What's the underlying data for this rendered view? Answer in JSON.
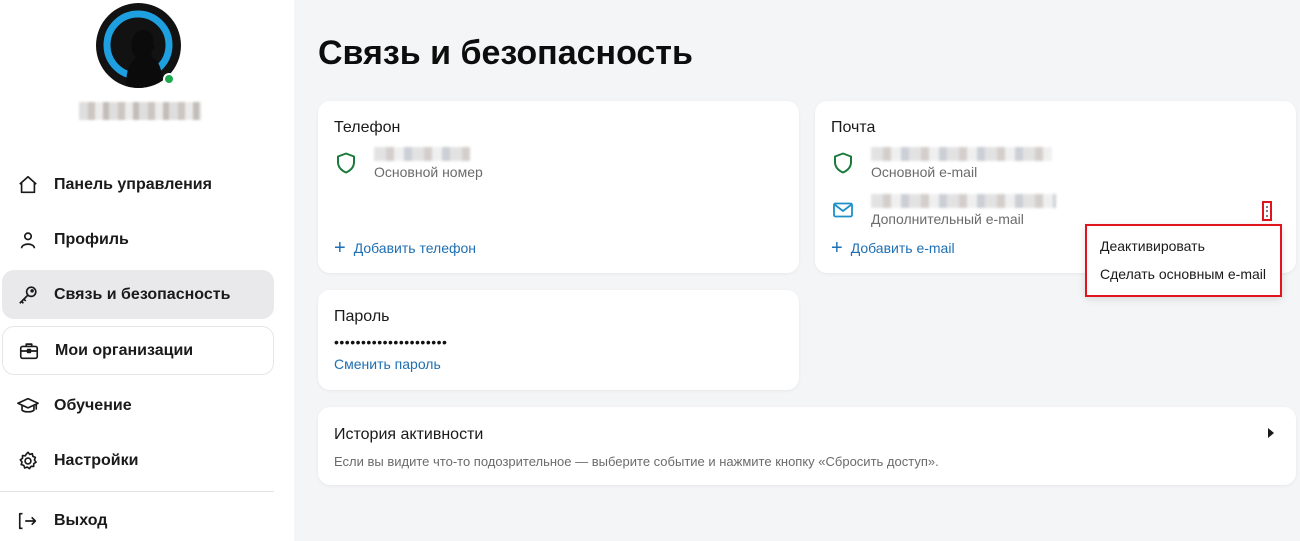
{
  "page": {
    "title": "Связь и безопасность"
  },
  "sidebar": {
    "items": [
      {
        "label": "Панель управления",
        "icon": "home-icon"
      },
      {
        "label": "Профиль",
        "icon": "person-icon"
      },
      {
        "label": "Связь и безопасность",
        "icon": "key-icon"
      },
      {
        "label": "Мои организации",
        "icon": "briefcase-icon"
      },
      {
        "label": "Обучение",
        "icon": "graduation-cap-icon"
      },
      {
        "label": "Настройки",
        "icon": "gear-icon"
      }
    ],
    "logout_label": "Выход"
  },
  "phone_card": {
    "title": "Телефон",
    "primary_sub": "Основной номер",
    "add_label": "Добавить телефон"
  },
  "email_card": {
    "title": "Почта",
    "primary_sub": "Основной e-mail",
    "secondary_sub": "Дополнительный e-mail",
    "add_label": "Добавить e-mail"
  },
  "password_card": {
    "title": "Пароль",
    "masked": "•••••••••••••••••••••",
    "change_label": "Сменить пароль"
  },
  "history_card": {
    "title": "История активности",
    "description": "Если вы видите что-то подозрительное — выберите событие и нажмите кнопку «Сбросить доступ»."
  },
  "context_menu": {
    "items": [
      "Деактивировать",
      "Сделать основным e-mail"
    ]
  },
  "colors": {
    "accent": "#1e6fb3",
    "shield": "#1a7a3a",
    "mail": "#1e90c8",
    "highlight": "#e0141c",
    "online": "#1fa84f"
  }
}
